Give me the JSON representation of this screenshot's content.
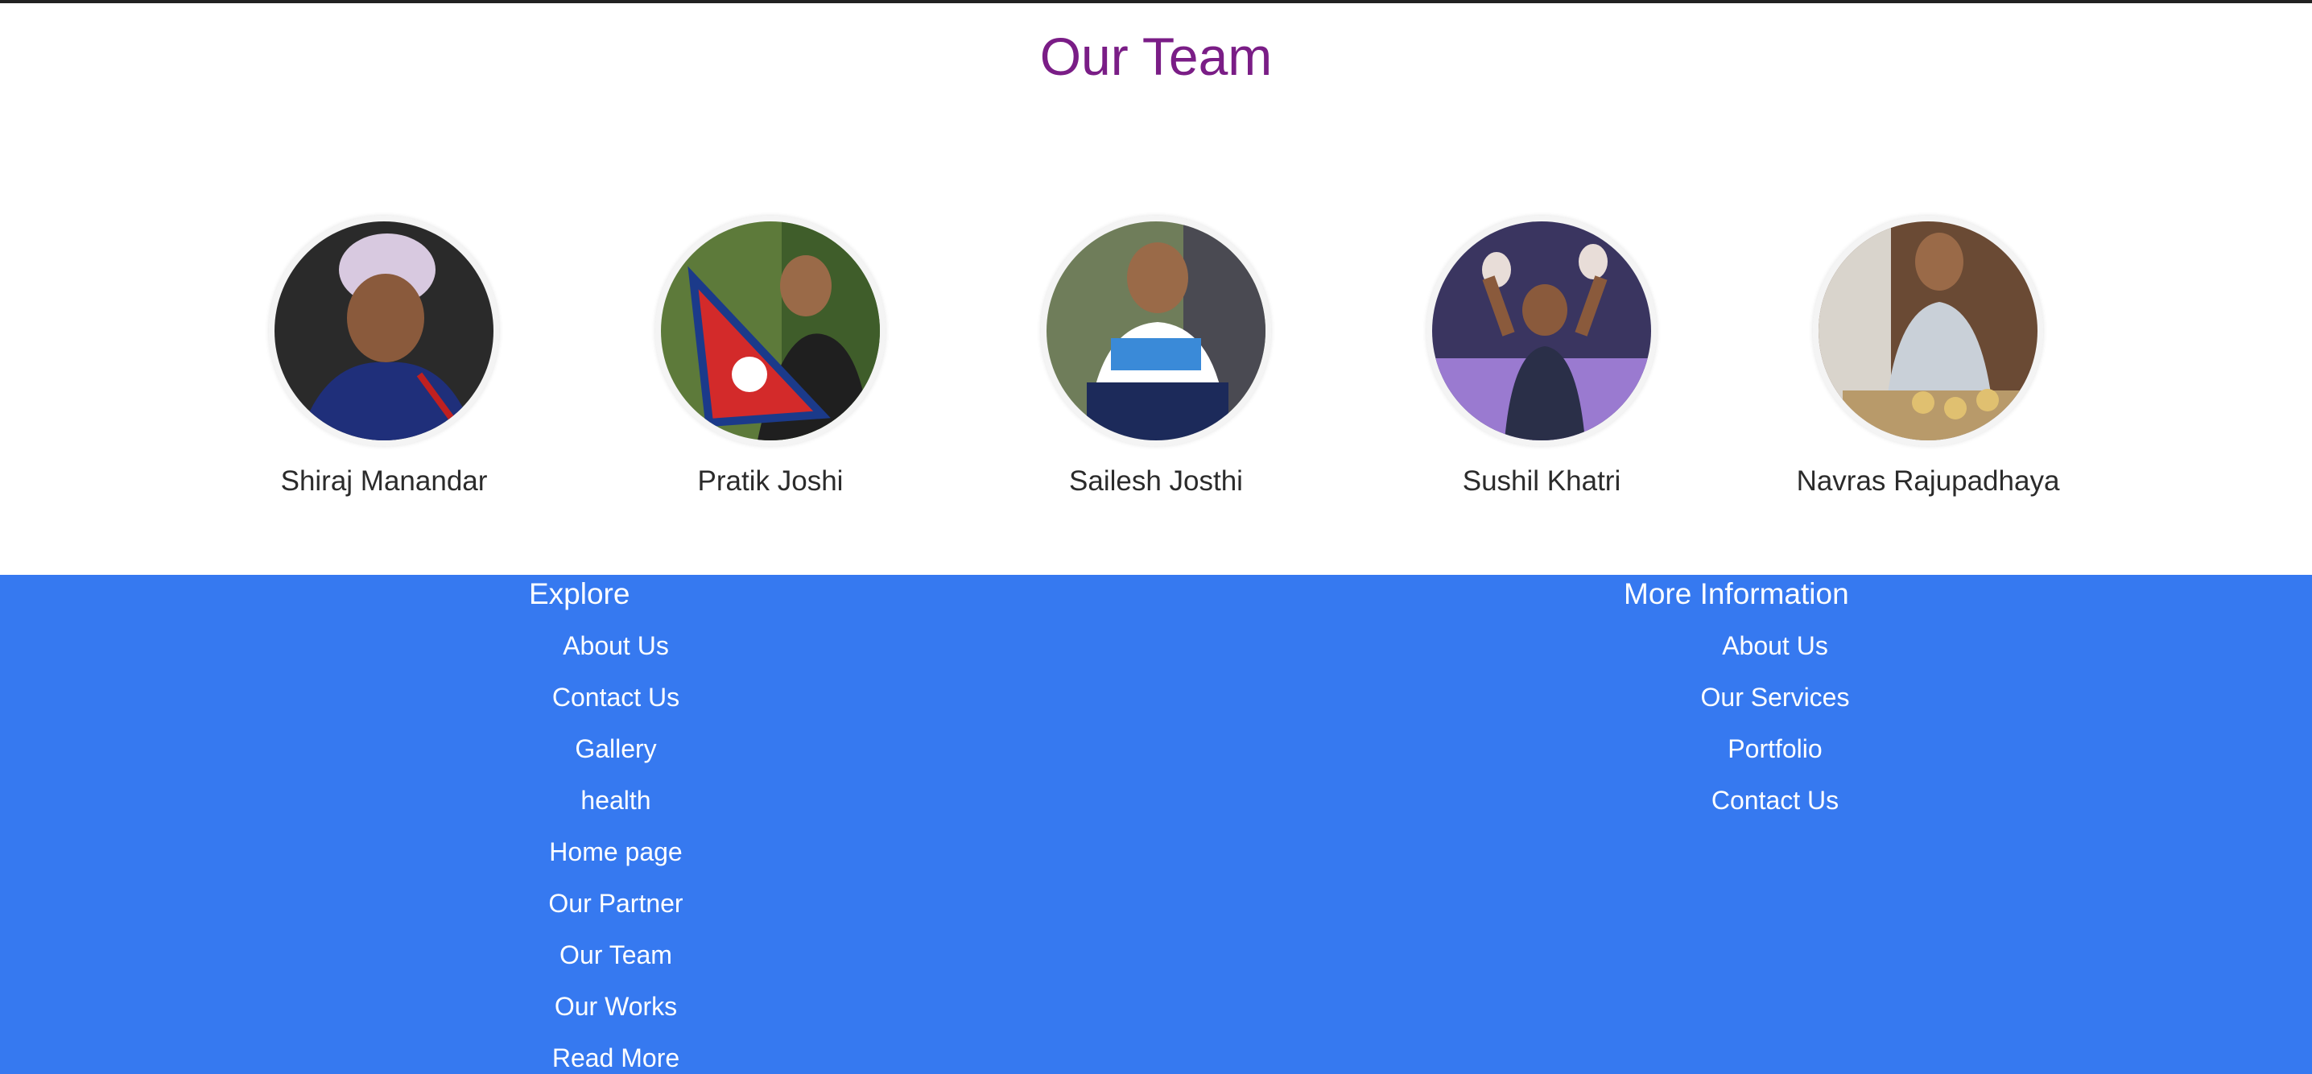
{
  "page": {
    "title": "Our Team",
    "title_color": "#7a1d86"
  },
  "team": {
    "members": [
      {
        "name": "Shiraj Manandar"
      },
      {
        "name": "Pratik Joshi"
      },
      {
        "name": "Sailesh Josthi"
      },
      {
        "name": "Sushil Khatri"
      },
      {
        "name": "Navras Rajupadhaya"
      }
    ]
  },
  "footer": {
    "background": "#3679f0",
    "explore": {
      "heading": "Explore",
      "links": [
        "About Us",
        "Contact Us",
        "Gallery",
        "health",
        "Home page",
        "Our Partner",
        "Our Team",
        "Our Works",
        "Read More"
      ]
    },
    "more_info": {
      "heading": "More Information",
      "links": [
        "About Us",
        "Our Services",
        "Portfolio",
        "Contact Us"
      ]
    }
  }
}
